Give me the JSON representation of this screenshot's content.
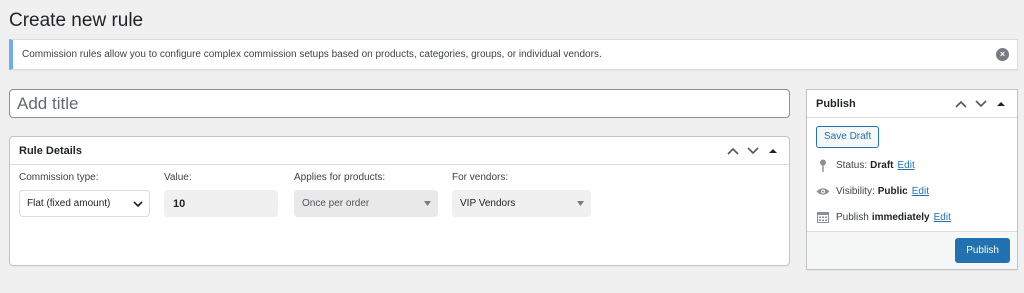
{
  "page": {
    "title": "Create new rule"
  },
  "notice": {
    "text": "Commission rules allow you to configure complex commission setups based on products, categories, groups, or individual vendors.",
    "dismiss_icon": "close-circle-icon"
  },
  "title_field": {
    "placeholder": "Add title",
    "value": ""
  },
  "rule_details": {
    "title": "Rule Details",
    "fields": {
      "commission_type": {
        "label": "Commission type:",
        "value": "Flat (fixed amount)"
      },
      "value": {
        "label": "Value:",
        "value": "10"
      },
      "applies": {
        "label": "Applies for products:",
        "value": "Once per order"
      },
      "vendors": {
        "label": "For vendors:",
        "value": "VIP Vendors"
      }
    }
  },
  "publish": {
    "title": "Publish",
    "save_draft_label": "Save Draft",
    "status": {
      "label": "Status:",
      "value": "Draft",
      "edit": "Edit"
    },
    "visibility": {
      "label": "Visibility:",
      "value": "Public",
      "edit": "Edit"
    },
    "schedule": {
      "label": "Publish",
      "value": "immediately",
      "edit": "Edit"
    },
    "publish_label": "Publish"
  },
  "colors": {
    "accent": "#2271b1",
    "notice_border": "#72aee6",
    "background": "#f0f0f1"
  }
}
